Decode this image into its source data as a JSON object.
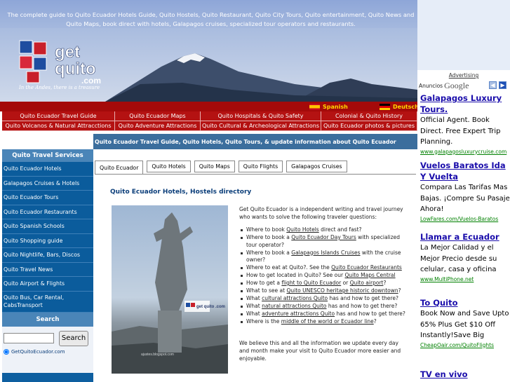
{
  "header": {
    "tagline": "The complete guide to Quito Ecuador Hotels Guide, Quito Hostels, Quito Restaurant, Quito City Tours, Quito entertainment, Quito News and Quito Maps, book direct with hotels, Galapagos cruises, specialized tour operators and restaurants.",
    "logo_text_1": "get",
    "logo_text_2": "quito",
    "logo_text_3": ".com",
    "slogan": "In the Andes, there is a treasure"
  },
  "languages": [
    {
      "label": "Spanish",
      "flag": "spain-flag-icon"
    },
    {
      "label": "Deutsch",
      "flag": "germany-flag-icon"
    }
  ],
  "menu": {
    "row1": [
      "Quito Ecuador Travel Guide",
      "Quito Ecuador Maps",
      "Quito Hospitals & Quito Safety",
      "Colonial & Quito History"
    ],
    "row2": [
      "Quito Volcanos & Natural Attracctions",
      "Quito Adventure Attractions",
      "Quito Cultural & Archeological Attractions",
      "Quito Ecuador photos & pictures"
    ]
  },
  "headline": "Quito Ecuador Travel Guide, Quito Hotels, Quito Tours, & update information about Quito Ecuador",
  "sidebar": {
    "header": "Quito Travel Services",
    "items": [
      "Quito Ecuador Hotels",
      "Galapagos Cruises & Hotels",
      "Quito Ecuador Tours",
      "Quito Ecuador Restaurants",
      "Quito Spanish Schools",
      "Quito Shopping guide",
      "Quito Nightlife, Bars, Discos",
      "Quito Travel News",
      "Quito Airport & Flights",
      "Quito Bus, Car Rental, CabsTransport"
    ],
    "search_header": "Search",
    "search_button": "Search",
    "search_value": "",
    "radio_label": "GetQuitoEcuador.com"
  },
  "tabs": [
    "Quito Ecuador",
    "Quito Hotels",
    "Quito Maps",
    "Quito Flights",
    "Galapagos Cruises"
  ],
  "content": {
    "title": "Quito Ecuador Hotels, Hostels directory",
    "intro": "Get Quito Ecuador is a independent writing and travel journey who wants to solve the following traveler questions:",
    "photo_watermark": "get quito .com",
    "photo_caption": "ajustes.blogspot.com",
    "questions": [
      {
        "pre": "Where to book ",
        "link": "Quito Hotels",
        "post": " direct and fast?"
      },
      {
        "pre": "Where to book a ",
        "link": "Quito Ecuador Day Tours",
        "post": " with specialized tour operator?"
      },
      {
        "pre": "Where to book a ",
        "link": "Galapagos Islands Cruises",
        "post": " with the cruise owner?"
      },
      {
        "pre": "Where to eat at Quito?. See the ",
        "link": "Quito Ecuador Restaurants",
        "post": ""
      },
      {
        "pre": "How to get located in Quito? See our ",
        "link": "Quito Maps Central",
        "post": ""
      },
      {
        "pre": "How to get a ",
        "link": "flight to Quito Ecuador",
        "post": " or ",
        "link2": "Quito airport",
        "post2": "?"
      },
      {
        "pre": "What to see at ",
        "link": "Quito UNESCO heritage historic downtown",
        "post": "?"
      },
      {
        "pre": "What ",
        "link": "cultural attractions Quito",
        "post": " has and how to get there?"
      },
      {
        "pre": "What ",
        "link": "natural attractions Quito",
        "post": " has and how to get there?"
      },
      {
        "pre": "What ",
        "link": "adventure attractions Quito",
        "post": " has and how to get there?"
      },
      {
        "pre": "Where is the ",
        "link": "middle of the world or Ecuador line",
        "post": "?"
      }
    ],
    "outro": "We believe this and all the information we update every day and month make your visit to Quito Ecuador more easier and enjoyable."
  },
  "ads": {
    "label": "Advertising",
    "anuncios": "Anuncios",
    "google": "Google",
    "items": [
      {
        "title": "Galapagos Luxury Tours.",
        "body": "Official Agent. Book Direct. Free Expert Trip Planning.",
        "url": "www.galapagosluxurycruise.com"
      },
      {
        "title": "Vuelos Baratos Ida Y Vuelta",
        "body": "Compara Las Tarifas Mas Bajas. ¡Compre Su Pasaje Ahora!",
        "url": "LowFares.com/Vuelos-Baratos"
      },
      {
        "title": "Llamar a Ecuador",
        "body": "La Mejor Calidad y el Mejor Precio desde su celular, casa y oficina",
        "url": "www.MultiPhone.net"
      },
      {
        "title": "To Quito",
        "body": "Book Now and Save Upto 65% Plus Get $10 Off Instantly!Save Big",
        "url": "CheapOair.com/QuitoFlights"
      },
      {
        "title": "TV en vivo",
        "body": "",
        "url": ""
      }
    ]
  },
  "colors": {
    "menu_red": "#b41212",
    "lang_bar": "#a40a0a",
    "sidebar_blue": "#0e5fa0",
    "headline_blue": "#3b6e9d",
    "ad_link": "#1a0dab",
    "ad_url": "#008000"
  }
}
